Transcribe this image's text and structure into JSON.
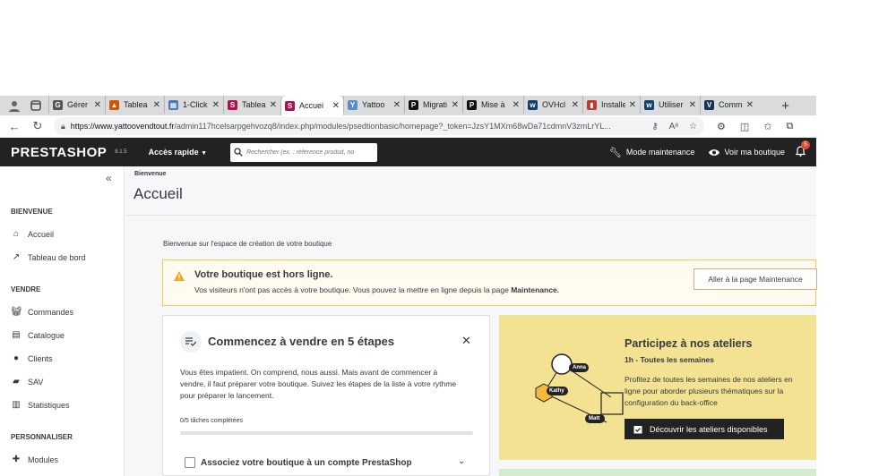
{
  "browser": {
    "tabs": [
      {
        "title": "Gérer l",
        "color": "#555",
        "icon": "G"
      },
      {
        "title": "Tablea",
        "color": "#d35400",
        "icon": "▲"
      },
      {
        "title": "1-Click",
        "color": "#4a7ab5",
        "icon": "▦"
      },
      {
        "title": "Tablea",
        "color": "#b0104f",
        "icon": "S"
      },
      {
        "title": "Accuei",
        "color": "#b0104f",
        "icon": "S"
      },
      {
        "title": "Yattoo",
        "color": "#5b8ec7",
        "icon": "Y"
      },
      {
        "title": "Migrati",
        "color": "#111",
        "icon": "P"
      },
      {
        "title": "Mise à",
        "color": "#111",
        "icon": "P"
      },
      {
        "title": "OVHcl",
        "color": "#123f6d",
        "icon": "w"
      },
      {
        "title": "Installe",
        "color": "#c0392b",
        "icon": "▮"
      },
      {
        "title": "Utiliser",
        "color": "#123f6d",
        "icon": "w"
      },
      {
        "title": "Comm",
        "color": "#1c2f5a",
        "icon": "V"
      }
    ],
    "active_tab": 4,
    "url_host": "https://www.yattoovendtout.fr",
    "url_path": "/admin117hcelsarpgehvozq8/index.php/modules/psedtionbasic/homepage?_token=JzsY1MXm68wDa71cdmnV3zmLrYL..."
  },
  "topbar": {
    "logo": "PRESTASHOP",
    "version": "8.1.5",
    "quick_access": "Accès rapide",
    "search_placeholder": "Rechercher (ex. : référence produit, no",
    "maintenance": "Mode maintenance",
    "view_shop": "Voir ma boutique",
    "notif_count": "5"
  },
  "sidebar": {
    "sections": [
      {
        "label": "BIENVENUE",
        "items": [
          {
            "label": "Accueil",
            "icon": "home-icon"
          },
          {
            "label": "Tableau de bord",
            "icon": "trending-icon"
          }
        ]
      },
      {
        "label": "VENDRE",
        "items": [
          {
            "label": "Commandes",
            "icon": "basket-icon"
          },
          {
            "label": "Catalogue",
            "icon": "store-icon"
          },
          {
            "label": "Clients",
            "icon": "account-icon"
          },
          {
            "label": "SAV",
            "icon": "chat-icon"
          },
          {
            "label": "Statistiques",
            "icon": "chart-icon"
          }
        ]
      },
      {
        "label": "PERSONNALISER",
        "items": [
          {
            "label": "Modules",
            "icon": "puzzle-icon"
          }
        ]
      }
    ]
  },
  "page": {
    "breadcrumb": "Bienvenue",
    "title": "Accueil",
    "welcome": "Bienvenue sur l'espace de création de votre boutique"
  },
  "alert": {
    "title": "Votre boutique est hors ligne.",
    "text": "Vos visiteurs n'ont pas accès à votre boutique. Vous pouvez la mettre en ligne depuis la page ",
    "link": "Maintenance.",
    "button": "Aller à la page Maintenance"
  },
  "steps": {
    "title": "Commencez à vendre en 5 étapes",
    "description": "Vous êtes impatient. On comprend, nous aussi. Mais avant de commencer à vendre, il faut préparer votre boutique. Suivez les étapes de la liste à votre rythme pour préparer le lancement.",
    "progress_text": "0/5 tâches complétées",
    "progress": 0,
    "first_step": "Associez votre boutique à un compte PrestaShop"
  },
  "workshops": {
    "title": "Participez à nos ateliers",
    "subtitle": "1h - Toutes les semaines",
    "text": "Profitez de toutes les semaines de nos ateliers en ligne pour aborder plusieurs thématiques sur la configuration du back-office",
    "button": "Découvrir les ateliers disponibles",
    "names": [
      "Anna",
      "Kathy",
      "Matt"
    ]
  }
}
